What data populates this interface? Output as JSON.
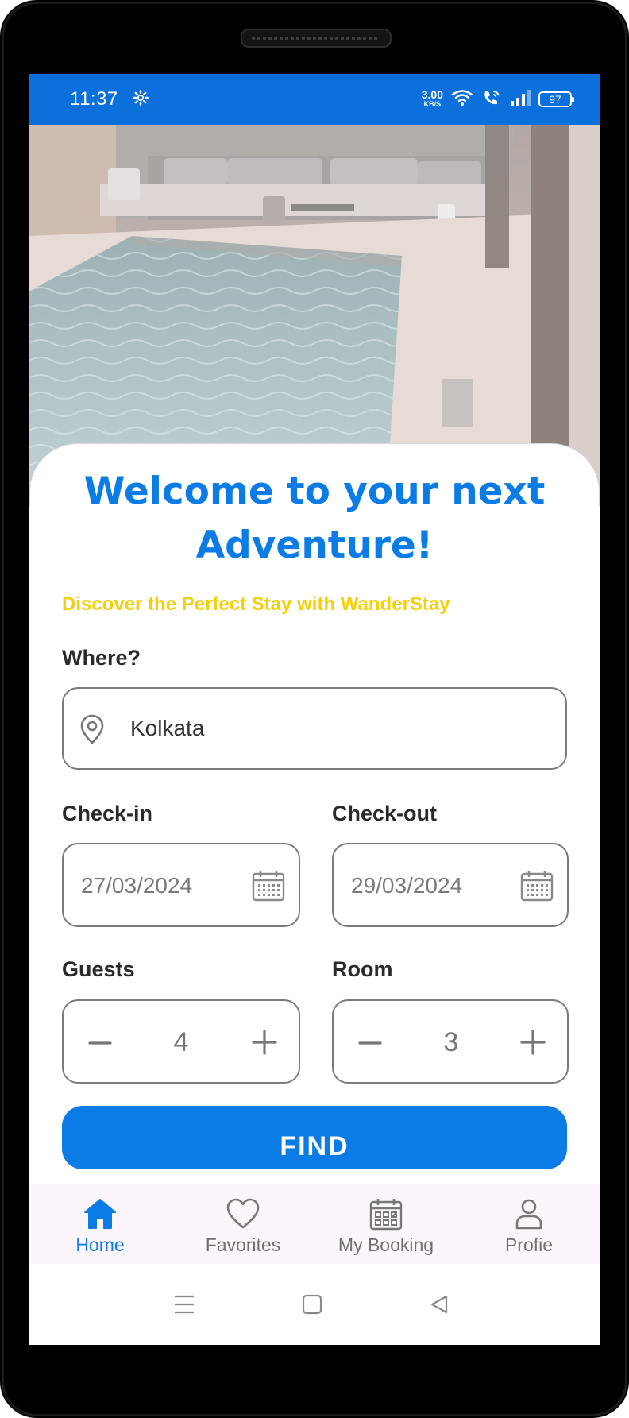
{
  "status_bar": {
    "time": "11:37",
    "net_speed_value": "3.00",
    "net_speed_unit": "KB/S",
    "battery": "97",
    "icons": [
      "gear-icon",
      "wifi-icon",
      "wifi-call-icon",
      "signal-icon",
      "battery-icon"
    ]
  },
  "hero": {
    "subject": "poolside-photo"
  },
  "welcome": {
    "title_line1": "Welcome to your next",
    "title_line2": "Adventure!",
    "subtitle": "Discover the Perfect Stay with WanderStay"
  },
  "form": {
    "where_label": "Where?",
    "where_value": "Kolkata",
    "checkin_label": "Check-in",
    "checkin_value": "27/03/2024",
    "checkout_label": "Check-out",
    "checkout_value": "29/03/2024",
    "guests_label": "Guests",
    "guests_value": "4",
    "room_label": "Room",
    "room_value": "3",
    "find_label": "FIND"
  },
  "bottom_nav": {
    "items": [
      {
        "label": "Home",
        "icon": "home-icon",
        "active": true
      },
      {
        "label": "Favorites",
        "icon": "heart-icon",
        "active": false
      },
      {
        "label": "My Booking",
        "icon": "calendar-icon",
        "active": false
      },
      {
        "label": "Profie",
        "icon": "user-icon",
        "active": false
      }
    ]
  },
  "colors": {
    "status_bar": "#0b6fdc",
    "accent": "#0b7be6",
    "subtitle": "#f4cf0b",
    "nav_background": "#fcf5fc"
  }
}
